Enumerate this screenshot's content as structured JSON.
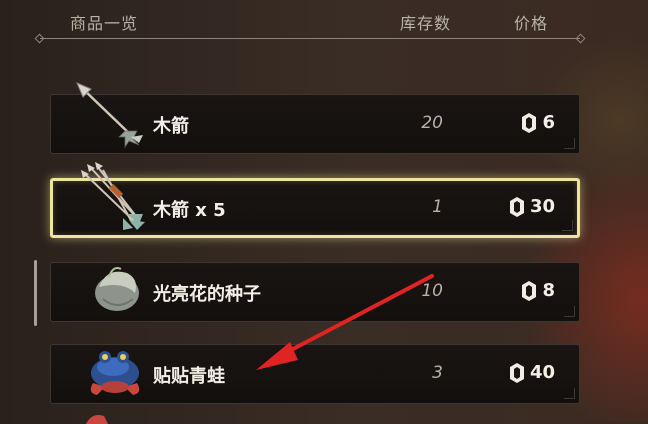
{
  "header": {
    "col_item": "商品一览",
    "col_stock": "库存数",
    "col_price": "价格"
  },
  "items": [
    {
      "name": "木箭",
      "stock": "20",
      "price": "6",
      "icon": "arrow-icon",
      "selected": false
    },
    {
      "name": "木箭 x 5",
      "stock": "1",
      "price": "30",
      "icon": "arrow-bundle-icon",
      "selected": true
    },
    {
      "name": "光亮花的种子",
      "stock": "10",
      "price": "8",
      "icon": "bright-seed-icon",
      "selected": false
    },
    {
      "name": "贴贴青蛙",
      "stock": "3",
      "price": "40",
      "icon": "sticky-frog-icon",
      "selected": false
    }
  ],
  "colors": {
    "selection_border": "#efe3a0",
    "annotation_arrow": "#e02424"
  }
}
